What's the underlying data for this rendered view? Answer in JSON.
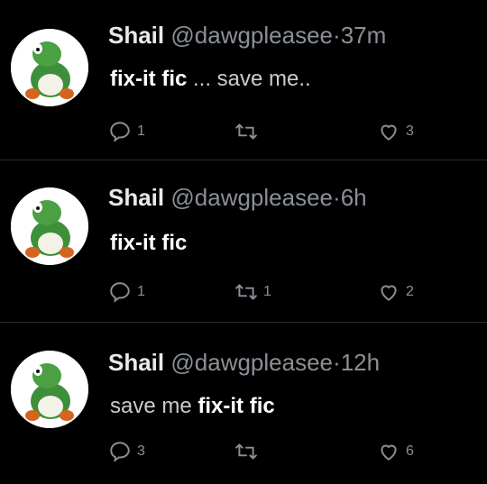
{
  "tweets": [
    {
      "name": "Shail",
      "handle": "@dawgpleasee",
      "separator": "·",
      "time": "37m",
      "text_parts": [
        {
          "style": "bold",
          "text": "fix-it fic"
        },
        {
          "style": "gray",
          "text": " ... save me.."
        }
      ],
      "replies": "1",
      "retweets": "",
      "likes": "3"
    },
    {
      "name": "Shail",
      "handle": "@dawgpleasee",
      "separator": "·",
      "time": "6h",
      "text_parts": [
        {
          "style": "bold",
          "text": "fix-it fic"
        },
        {
          "style": "gray",
          "text": ""
        }
      ],
      "replies": "1",
      "retweets": "1",
      "likes": "2"
    },
    {
      "name": "Shail",
      "handle": "@dawgpleasee",
      "separator": "·",
      "time": "12h",
      "text_parts": [
        {
          "style": "gray",
          "text": "save me "
        },
        {
          "style": "bold",
          "text": "fix-it fic"
        }
      ],
      "replies": "3",
      "retweets": "",
      "likes": "6"
    }
  ],
  "icons": {
    "reply": "reply-icon",
    "retweet": "retweet-icon",
    "like": "heart-icon",
    "avatar": "green-dino-avatar"
  },
  "colors": {
    "background": "#000000",
    "text": "#e7e9ea",
    "muted": "#8b9096"
  }
}
